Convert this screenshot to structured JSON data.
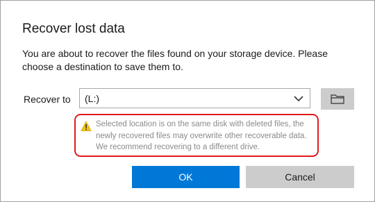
{
  "dialog": {
    "title": "Recover lost data",
    "description": "You are about to recover the files found on your storage device. Please choose a destination to save them to."
  },
  "destination": {
    "label": "Recover to",
    "selected_value": "(L:)",
    "chevron_icon": "chevron-down-icon",
    "browse_icon": "folder-icon"
  },
  "warning": {
    "icon": "warning-triangle-icon",
    "text": "Selected location is on the same disk with deleted files, the newly recovered files may overwrite other recoverable data. We recommend recovering to a different drive.",
    "border_color": "#e01b1b"
  },
  "buttons": {
    "ok_label": "OK",
    "cancel_label": "Cancel",
    "ok_color": "#0078d7",
    "cancel_color": "#cccccc"
  }
}
